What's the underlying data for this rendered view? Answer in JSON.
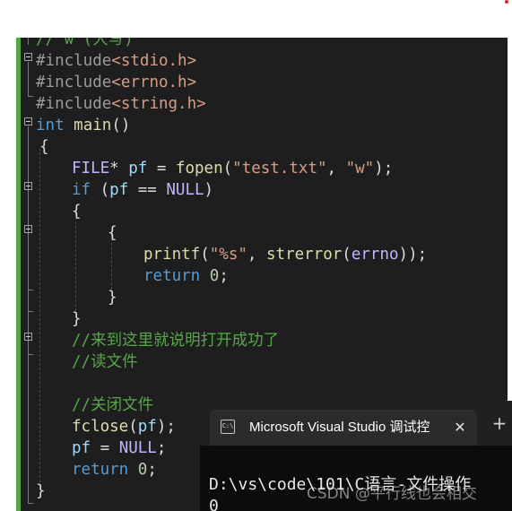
{
  "editor": {
    "lines": [
      [
        {
          "t": "// w (大写)",
          "c": "cm"
        }
      ],
      [
        {
          "t": "#include",
          "c": "pp"
        },
        {
          "t": "<stdio.h>",
          "c": "str"
        }
      ],
      [
        {
          "t": "#include",
          "c": "pp"
        },
        {
          "t": "<errno.h>",
          "c": "str"
        }
      ],
      [
        {
          "t": "#include",
          "c": "pp"
        },
        {
          "t": "<string.h>",
          "c": "str"
        }
      ],
      [
        {
          "t": "int",
          "c": "kw"
        },
        {
          "t": " ",
          "c": "pl"
        },
        {
          "t": "main",
          "c": "fn"
        },
        {
          "t": "()",
          "c": "pl"
        }
      ],
      [
        {
          "t": "{",
          "c": "pl"
        }
      ],
      [
        {
          "t": "FILE",
          "c": "mac"
        },
        {
          "t": "* ",
          "c": "pl"
        },
        {
          "t": "pf",
          "c": "var"
        },
        {
          "t": " = ",
          "c": "pl"
        },
        {
          "t": "fopen",
          "c": "fn"
        },
        {
          "t": "(",
          "c": "pl"
        },
        {
          "t": "\"test.txt\"",
          "c": "str"
        },
        {
          "t": ", ",
          "c": "pl"
        },
        {
          "t": "\"w\"",
          "c": "str"
        },
        {
          "t": ");",
          "c": "pl"
        }
      ],
      [
        {
          "t": "if",
          "c": "kw"
        },
        {
          "t": " (",
          "c": "pl"
        },
        {
          "t": "pf",
          "c": "var"
        },
        {
          "t": " == ",
          "c": "pl"
        },
        {
          "t": "NULL",
          "c": "mac"
        },
        {
          "t": ")",
          "c": "pl"
        }
      ],
      [
        {
          "t": "{",
          "c": "pl"
        }
      ],
      [
        {
          "t": "{",
          "c": "pl"
        }
      ],
      [
        {
          "t": "printf",
          "c": "fn"
        },
        {
          "t": "(",
          "c": "pl"
        },
        {
          "t": "\"%s\"",
          "c": "str"
        },
        {
          "t": ", ",
          "c": "pl"
        },
        {
          "t": "strerror",
          "c": "fn"
        },
        {
          "t": "(",
          "c": "pl"
        },
        {
          "t": "errno",
          "c": "mac"
        },
        {
          "t": "));",
          "c": "pl"
        }
      ],
      [
        {
          "t": "return",
          "c": "kw"
        },
        {
          "t": " ",
          "c": "pl"
        },
        {
          "t": "0",
          "c": "num"
        },
        {
          "t": ";",
          "c": "pl"
        }
      ],
      [
        {
          "t": "}",
          "c": "pl"
        }
      ],
      [
        {
          "t": "}",
          "c": "pl"
        }
      ],
      [
        {
          "t": "//来到这里就说明打开成功了",
          "c": "cm"
        }
      ],
      [
        {
          "t": "//读文件",
          "c": "cm"
        }
      ],
      [],
      [
        {
          "t": "//关闭文件",
          "c": "cm"
        }
      ],
      [
        {
          "t": "fclose",
          "c": "fn"
        },
        {
          "t": "(",
          "c": "pl"
        },
        {
          "t": "pf",
          "c": "var"
        },
        {
          "t": ");",
          "c": "pl"
        }
      ],
      [
        {
          "t": "pf",
          "c": "var"
        },
        {
          "t": " = ",
          "c": "pl"
        },
        {
          "t": "NULL",
          "c": "mac"
        },
        {
          "t": ";",
          "c": "pl"
        }
      ],
      [
        {
          "t": "return",
          "c": "kw"
        },
        {
          "t": " ",
          "c": "pl"
        },
        {
          "t": "0",
          "c": "num"
        },
        {
          "t": ";",
          "c": "pl"
        }
      ],
      [
        {
          "t": "}",
          "c": "pl"
        }
      ]
    ]
  },
  "console": {
    "tab_icon_label": "C:\\",
    "tab_title": "Microsoft Visual Studio 调试控",
    "close_glyph": "✕",
    "add_glyph": "+",
    "output_line1": "D:\\vs\\code\\101\\C语言-文件操作",
    "output_line2": "0"
  },
  "watermark": "CSDN @平行线也会相交"
}
